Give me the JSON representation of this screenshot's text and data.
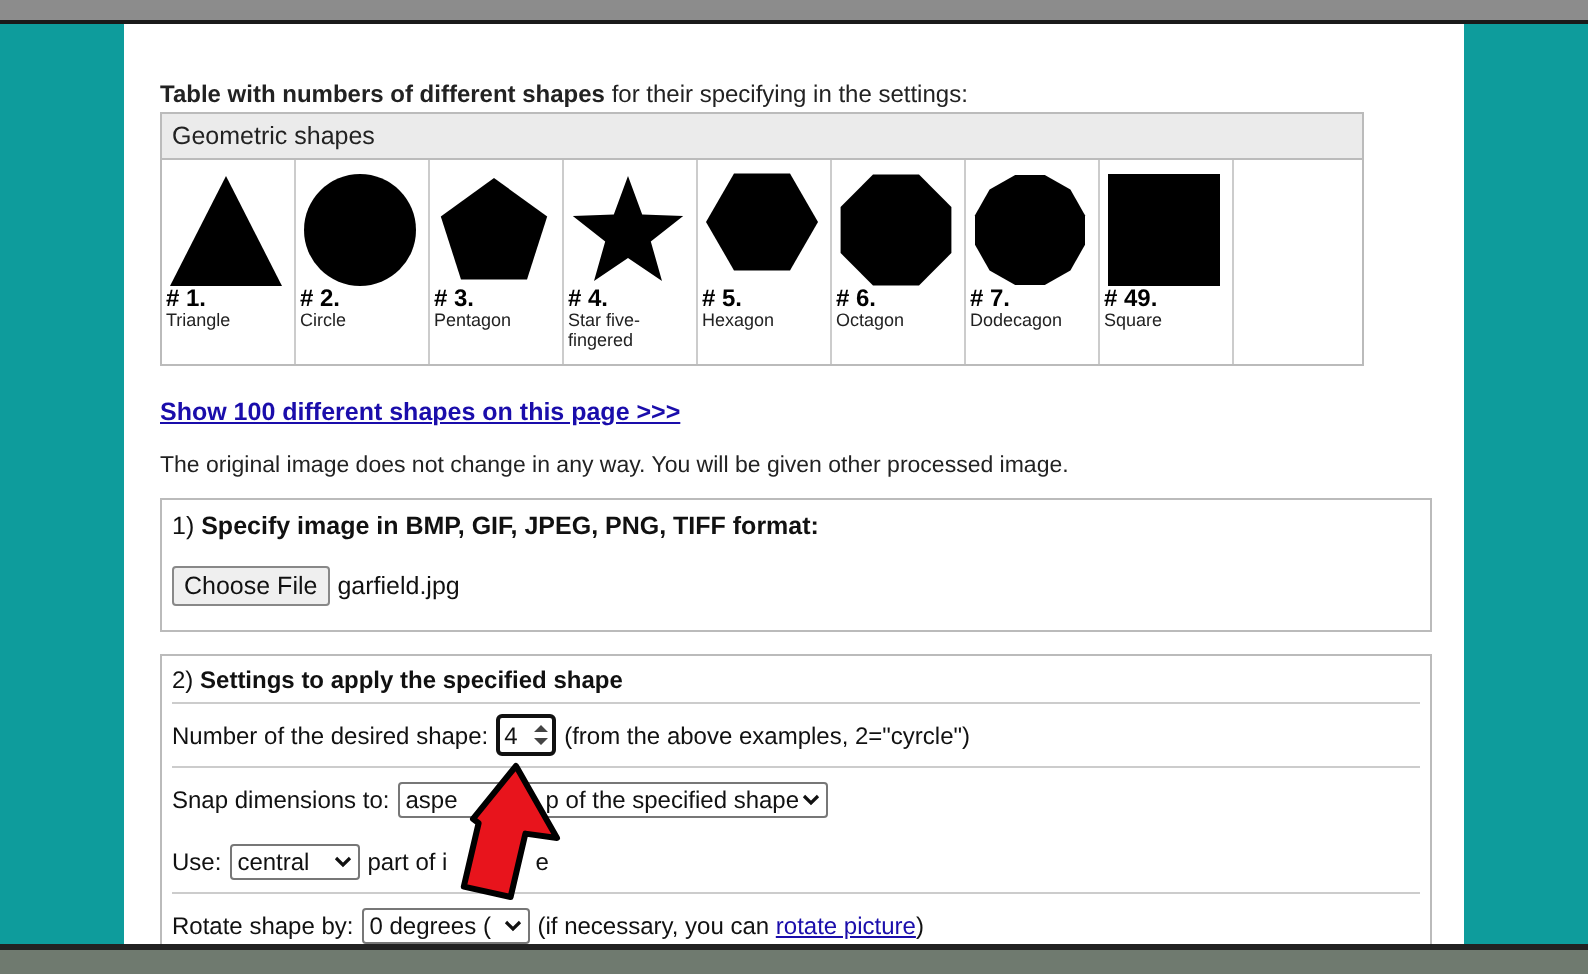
{
  "intro": "**Table with numbers of different shapes** for their specifying in the settings:",
  "shape_table": {
    "heading": "Geometric shapes",
    "shapes": [
      {
        "kind": "triangle",
        "number": "# 1.",
        "name": "Triangle"
      },
      {
        "kind": "circle",
        "number": "# 2.",
        "name": "Circle"
      },
      {
        "kind": "pentagon",
        "number": "# 3.",
        "name": "Pentagon"
      },
      {
        "kind": "star",
        "number": "# 4.",
        "name": "Star five-fingered"
      },
      {
        "kind": "hexagon",
        "number": "# 5.",
        "name": "Hexagon"
      },
      {
        "kind": "octagon",
        "number": "# 6.",
        "name": "Octagon"
      },
      {
        "kind": "dodecagon",
        "number": "# 7.",
        "name": "Dodecagon"
      },
      {
        "kind": "square",
        "number": "# 49.",
        "name": "Square"
      }
    ]
  },
  "link": "Show 100 different shapes on this page >>>",
  "note": "The original image does not change in any way. You will be given other processed image.",
  "upload": {
    "title": "1) **Specify image in BMP, GIF, JPEG, PNG, TIFF format:**",
    "button": "Choose File",
    "file": "garfield.jpg"
  },
  "settings": {
    "title": "2) **Settings to apply the specified shape**",
    "groups": [
      [
        {
          "kind": "number",
          "label": "Number of the desired shape:",
          "value": "4",
          "after": [
            "(from the above examples, 2=\"cyrcle\")"
          ]
        }
      ],
      [
        {
          "kind": "select",
          "label": "Snap dimensions to:",
          "value": [
            "aspe",
            "p of the specified shape"
          ]
        },
        {
          "kind": "select",
          "label": "Use:",
          "value": [
            "central"
          ],
          "after": [
            "part of i",
            "e"
          ]
        }
      ],
      [
        {
          "kind": "select",
          "label": "Rotate shape by:",
          "value": [
            "0 degrees ("
          ],
          "after": [
            "(if necessary, you can "
          ],
          "link": "rotate picture",
          "after_end": ")"
        }
      ]
    ]
  }
}
